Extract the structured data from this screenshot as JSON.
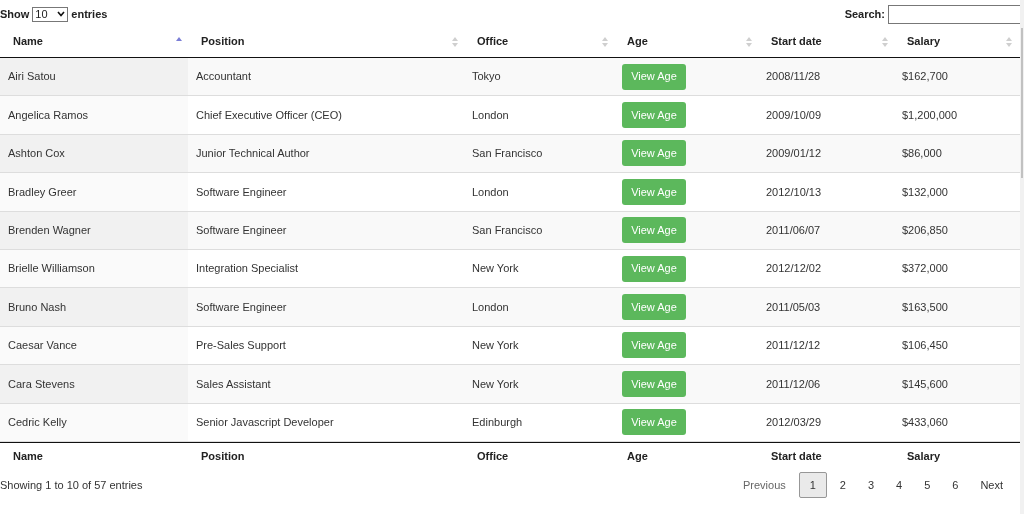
{
  "length_control": {
    "label_before": "Show",
    "value": "10",
    "label_after": "entries"
  },
  "search": {
    "label": "Search:"
  },
  "table": {
    "columns": [
      {
        "label": "Name",
        "sorted": true
      },
      {
        "label": "Position",
        "sorted": false
      },
      {
        "label": "Office",
        "sorted": false
      },
      {
        "label": "Age",
        "sorted": false
      },
      {
        "label": "Start date",
        "sorted": false
      },
      {
        "label": "Salary",
        "sorted": false
      }
    ],
    "rows": [
      [
        "Airi Satou",
        "Accountant",
        "Tokyo",
        "View Age",
        "2008/11/28",
        "$162,700"
      ],
      [
        "Angelica Ramos",
        "Chief Executive Officer (CEO)",
        "London",
        "View Age",
        "2009/10/09",
        "$1,200,000"
      ],
      [
        "Ashton Cox",
        "Junior Technical Author",
        "San Francisco",
        "View Age",
        "2009/01/12",
        "$86,000"
      ],
      [
        "Bradley Greer",
        "Software Engineer",
        "London",
        "View Age",
        "2012/10/13",
        "$132,000"
      ],
      [
        "Brenden Wagner",
        "Software Engineer",
        "San Francisco",
        "View Age",
        "2011/06/07",
        "$206,850"
      ],
      [
        "Brielle Williamson",
        "Integration Specialist",
        "New York",
        "View Age",
        "2012/12/02",
        "$372,000"
      ],
      [
        "Bruno Nash",
        "Software Engineer",
        "London",
        "View Age",
        "2011/05/03",
        "$163,500"
      ],
      [
        "Caesar Vance",
        "Pre-Sales Support",
        "New York",
        "View Age",
        "2011/12/12",
        "$106,450"
      ],
      [
        "Cara Stevens",
        "Sales Assistant",
        "New York",
        "View Age",
        "2011/12/06",
        "$145,600"
      ],
      [
        "Cedric Kelly",
        "Senior Javascript Developer",
        "Edinburgh",
        "View Age",
        "2012/03/29",
        "$433,060"
      ]
    ],
    "footer": [
      "Name",
      "Position",
      "Office",
      "Age",
      "Start date",
      "Salary"
    ]
  },
  "info": "Showing 1 to 10 of 57 entries",
  "pagination": [
    {
      "label": "Previous",
      "selected": false,
      "disabled": true
    },
    {
      "label": "1",
      "selected": true,
      "disabled": false
    },
    {
      "label": "2",
      "selected": false,
      "disabled": false
    },
    {
      "label": "3",
      "selected": false,
      "disabled": false
    },
    {
      "label": "4",
      "selected": false,
      "disabled": false
    },
    {
      "label": "5",
      "selected": false,
      "disabled": false
    },
    {
      "label": "6",
      "selected": false,
      "disabled": false
    },
    {
      "label": "Next",
      "selected": false,
      "disabled": false
    }
  ]
}
